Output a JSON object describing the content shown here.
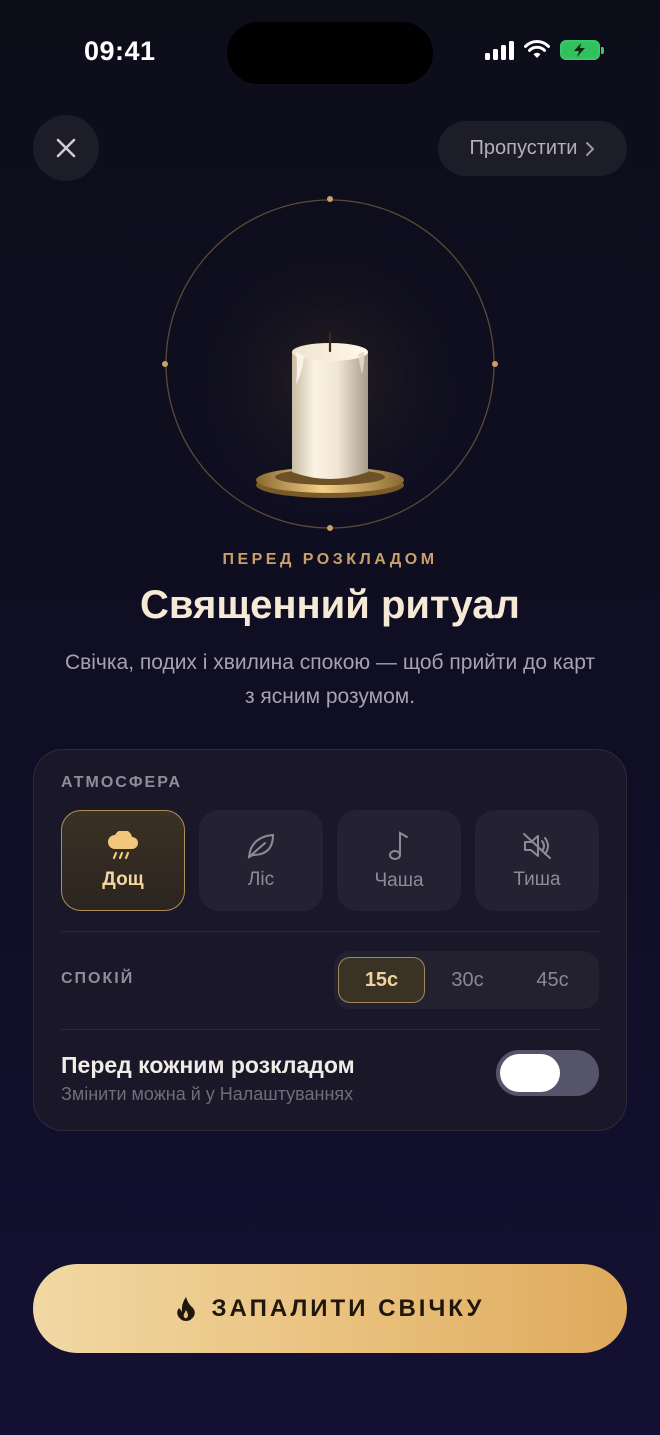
{
  "status_bar": {
    "time": "09:41",
    "battery_color": "#30c15d"
  },
  "header": {
    "close_icon": "close-icon",
    "skip_label": "Пропустити"
  },
  "hero": {
    "eyebrow": "ПЕРЕД РОЗКЛАДОМ",
    "title": "Священний ритуал",
    "subtitle": "Свічка, подих і хвилина спокою — щоб прийти до карт з ясним розумом."
  },
  "settings": {
    "atmosphere_label": "АТМОСФЕРА",
    "atmospheres": [
      {
        "label": "Дощ",
        "icon": "rain-cloud-icon",
        "selected": true
      },
      {
        "label": "Ліс",
        "icon": "leaf-icon",
        "selected": false
      },
      {
        "label": "Чаша",
        "icon": "music-note-icon",
        "selected": false
      },
      {
        "label": "Тиша",
        "icon": "mute-icon",
        "selected": false
      }
    ],
    "calm_label": "СПОКІЙ",
    "calm_options": [
      {
        "label": "15с",
        "selected": true
      },
      {
        "label": "30с",
        "selected": false
      },
      {
        "label": "45с",
        "selected": false
      }
    ],
    "toggle_title": "Перед кожним розкладом",
    "toggle_subtitle": "Змінити можна й у Налаштуваннях",
    "toggle_on": false
  },
  "cta": {
    "label": "ЗАПАЛИТИ СВІЧКУ",
    "icon": "flame-icon"
  },
  "colors": {
    "accent_gold": "#c9a06a",
    "background": "#0f0e22",
    "card": "#1a1828"
  }
}
